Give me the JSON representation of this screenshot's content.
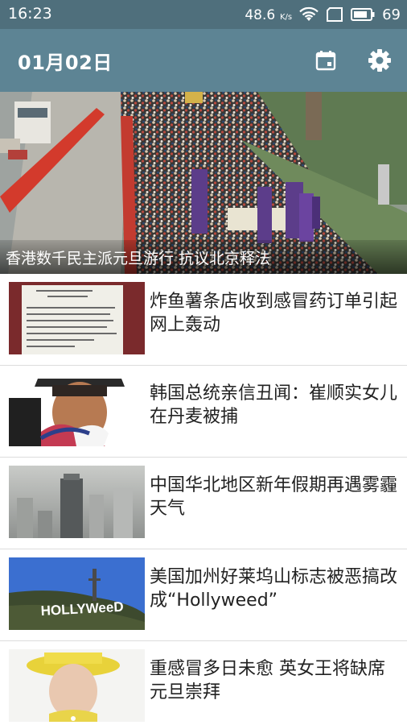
{
  "status_bar": {
    "time": "16:23",
    "speed": "48.6",
    "speed_unit": "K/s",
    "battery": "69",
    "icons": [
      "wifi-icon",
      "sim-icon",
      "battery-icon"
    ]
  },
  "app_bar": {
    "date": "01月02日",
    "icons": [
      "calendar-icon",
      "settings-gear-icon"
    ],
    "color": "#5d8494"
  },
  "hero": {
    "caption": "香港数千民主派元旦游行 抗议北京释法"
  },
  "news": [
    {
      "title": "炸鱼薯条店收到感冒药订单引起网上轰动",
      "thumb": "receipt-image"
    },
    {
      "title": "韩国总统亲信丑闻：崔顺实女儿在丹麦被捕",
      "thumb": "rider-image"
    },
    {
      "title": "中国华北地区新年假期再遇雾霾天气",
      "thumb": "smog-city-image"
    },
    {
      "title": "美国加州好莱坞山标志被恶搞改成“Hollyweed”",
      "thumb": "hollyweed-sign-image",
      "sign_text": "HOLLYWeeD"
    },
    {
      "title": "重感冒多日未愈 英女王将缺席元旦崇拜",
      "thumb": "queen-image"
    }
  ],
  "colors": {
    "status_bar": "#4f6f7c",
    "app_bar": "#5d8494",
    "divider": "#dcdcdc",
    "title_text": "#222222"
  }
}
